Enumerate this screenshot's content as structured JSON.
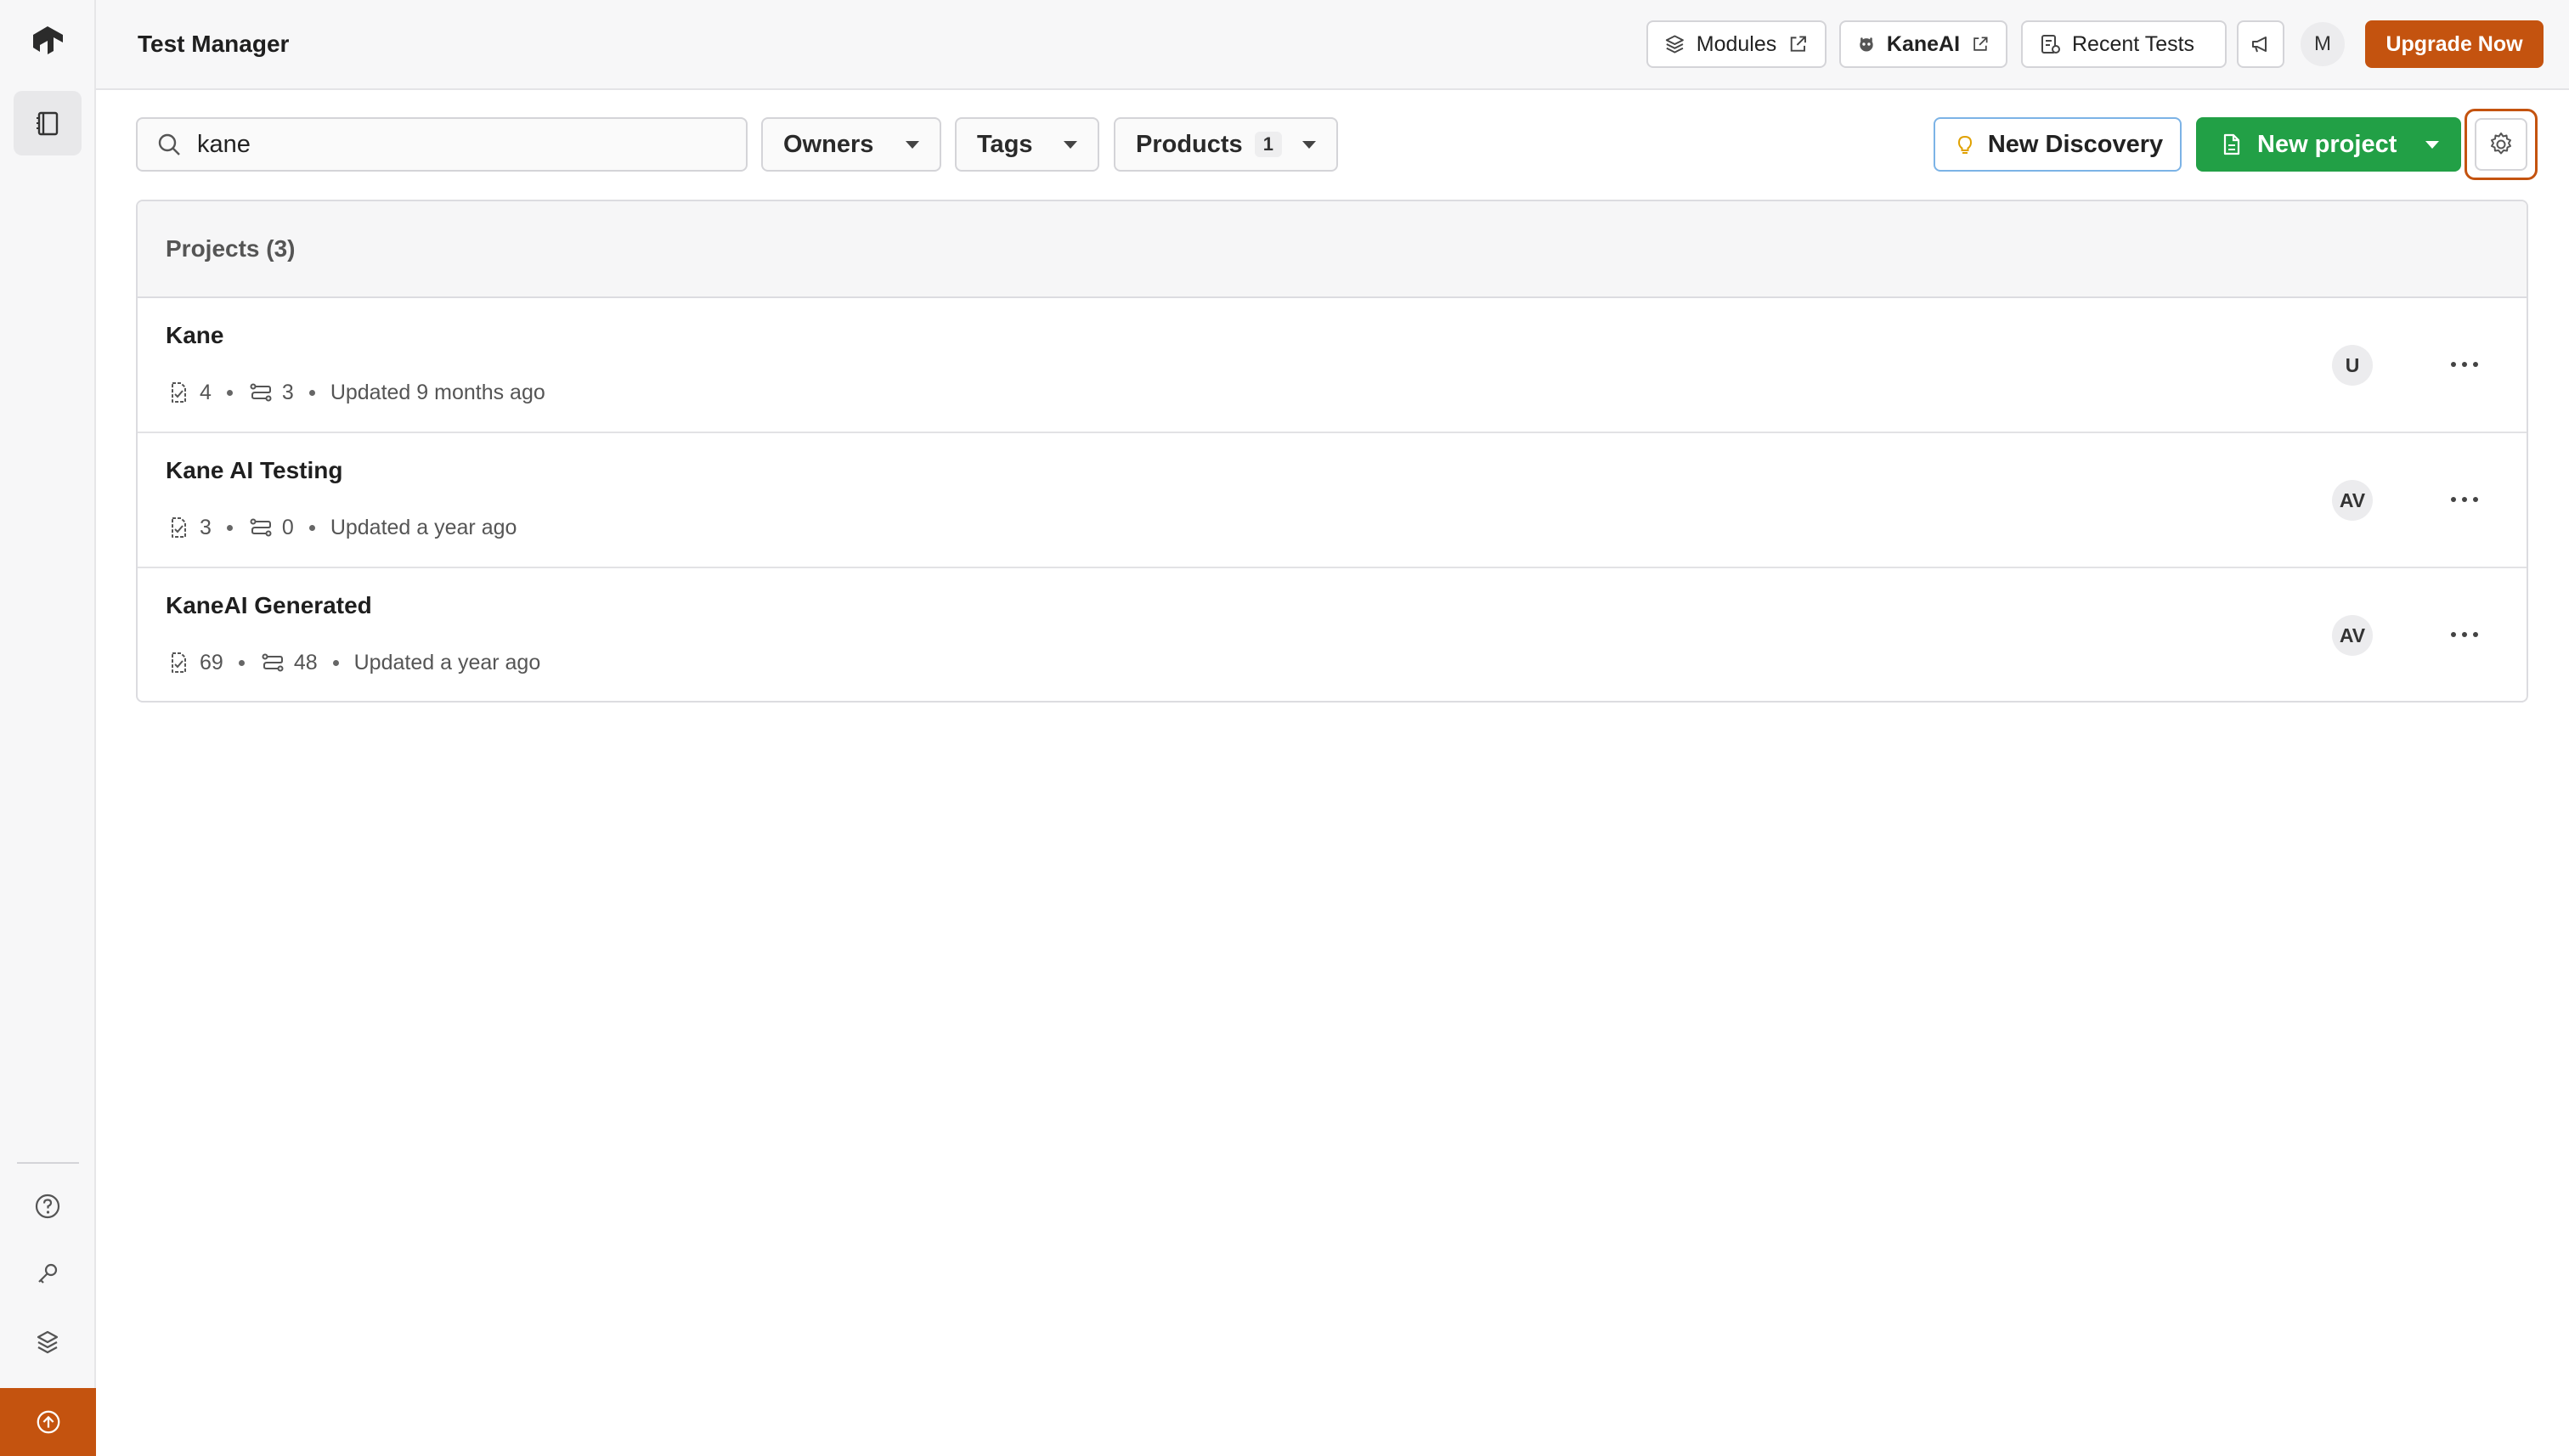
{
  "header": {
    "title": "Test Manager",
    "modules_label": "Modules",
    "kaneai_label": "KaneAI",
    "recent_tests_label": "Recent Tests",
    "user_initial": "M",
    "upgrade_label": "Upgrade Now"
  },
  "toolbar": {
    "search_value": "kane",
    "filters": {
      "owners": "Owners",
      "tags": "Tags",
      "products": "Products",
      "products_count": "1"
    },
    "new_discovery_label": "New Discovery",
    "new_project_label": "New project"
  },
  "projects": {
    "heading": "Projects (3)",
    "rows": [
      {
        "name": "Kane",
        "test_cases": "4",
        "test_runs": "3",
        "updated": "Updated 9 months ago",
        "owner": "U"
      },
      {
        "name": "Kane AI Testing",
        "test_cases": "3",
        "test_runs": "0",
        "updated": "Updated a year ago",
        "owner": "AV"
      },
      {
        "name": "KaneAI Generated",
        "test_cases": "69",
        "test_runs": "48",
        "updated": "Updated a year ago",
        "owner": "AV"
      }
    ]
  },
  "colors": {
    "brand": "#c4530f",
    "primary_green": "#22a046",
    "discovery_border": "#7cb3e6"
  },
  "icons": {
    "sidebar": [
      "logo-icon",
      "notebook-icon",
      "help-icon",
      "key-icon",
      "layers-icon",
      "upgrade-arrow-icon"
    ],
    "header": [
      "layers-icon",
      "external-link-icon",
      "kaneai-icon",
      "recent-tests-icon",
      "megaphone-icon"
    ],
    "toolbar": [
      "search-icon",
      "lightbulb-icon",
      "document-icon",
      "gear-icon"
    ],
    "rows": [
      "test-case-icon",
      "test-run-icon",
      "more-icon"
    ]
  }
}
